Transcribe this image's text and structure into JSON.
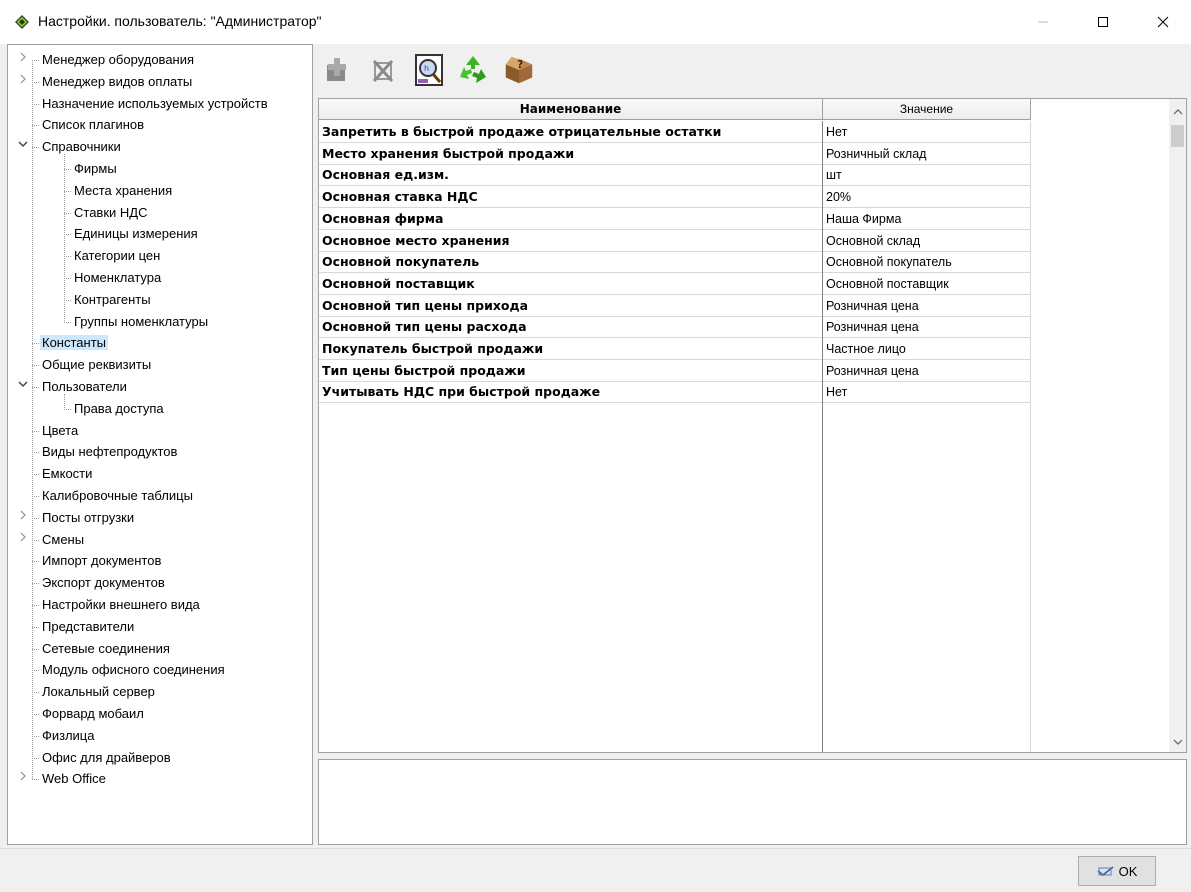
{
  "window": {
    "title": "Настройки. пользователь: \"Администратор\"",
    "min_icon": "minimize-icon",
    "max_icon": "maximize-icon",
    "close_icon": "close-icon"
  },
  "tree": [
    {
      "label": "Менеджер оборудования",
      "expander": ">",
      "level": 0
    },
    {
      "label": "Менеджер видов оплаты",
      "expander": ">",
      "level": 0
    },
    {
      "label": "Назначение используемых устройств",
      "expander": "",
      "level": 0
    },
    {
      "label": "Список плагинов",
      "expander": "",
      "level": 0
    },
    {
      "label": "Справочники",
      "expander": "v",
      "level": 0
    },
    {
      "label": "Фирмы",
      "expander": "",
      "level": 1
    },
    {
      "label": "Места хранения",
      "expander": "",
      "level": 1
    },
    {
      "label": "Ставки НДС",
      "expander": "",
      "level": 1
    },
    {
      "label": "Единицы измерения",
      "expander": "",
      "level": 1
    },
    {
      "label": "Категории цен",
      "expander": "",
      "level": 1
    },
    {
      "label": "Номенклатура",
      "expander": "",
      "level": 1
    },
    {
      "label": "Контрагенты",
      "expander": "",
      "level": 1
    },
    {
      "label": "Группы номенклатуры",
      "expander": "",
      "level": 1
    },
    {
      "label": "Константы",
      "expander": "",
      "level": 0,
      "selected": true
    },
    {
      "label": "Общие реквизиты",
      "expander": "",
      "level": 0
    },
    {
      "label": "Пользователи",
      "expander": "v",
      "level": 0
    },
    {
      "label": "Права доступа",
      "expander": "",
      "level": 1
    },
    {
      "label": "Цвета",
      "expander": "",
      "level": 0
    },
    {
      "label": "Виды нефтепродуктов",
      "expander": "",
      "level": 0
    },
    {
      "label": "Емкости",
      "expander": "",
      "level": 0
    },
    {
      "label": "Калибровочные таблицы",
      "expander": "",
      "level": 0
    },
    {
      "label": "Посты отгрузки",
      "expander": ">",
      "level": 0
    },
    {
      "label": "Смены",
      "expander": ">",
      "level": 0
    },
    {
      "label": "Импорт документов",
      "expander": "",
      "level": 0
    },
    {
      "label": "Экспорт документов",
      "expander": "",
      "level": 0
    },
    {
      "label": "Настройки внешнего вида",
      "expander": "",
      "level": 0
    },
    {
      "label": "Представители",
      "expander": "",
      "level": 0
    },
    {
      "label": "Сетевые соединения",
      "expander": "",
      "level": 0
    },
    {
      "label": "Модуль офисного соединения",
      "expander": "",
      "level": 0
    },
    {
      "label": "Локальный сервер",
      "expander": "",
      "level": 0
    },
    {
      "label": "Форвард мобаил",
      "expander": "",
      "level": 0
    },
    {
      "label": "Физлица",
      "expander": "",
      "level": 0
    },
    {
      "label": "Офис для драйверов",
      "expander": "",
      "level": 0
    },
    {
      "label": "Web Office",
      "expander": ">",
      "level": 0
    }
  ],
  "toolbar": {
    "buttons": [
      "add-icon",
      "delete-icon",
      "search-icon",
      "refresh-icon",
      "help-box-icon"
    ]
  },
  "grid": {
    "headers": {
      "name": "Наименование",
      "value": "Значение"
    },
    "rows": [
      {
        "name": "Запретить в быстрой продаже отрицательные остатки",
        "value": "Нет"
      },
      {
        "name": "Место хранения быстрой продажи",
        "value": "Розничный склад"
      },
      {
        "name": "Основная ед.изм.",
        "value": "шт"
      },
      {
        "name": "Основная ставка НДС",
        "value": "20%"
      },
      {
        "name": "Основная фирма",
        "value": "Наша Фирма"
      },
      {
        "name": "Основное место хранения",
        "value": "Основной склад"
      },
      {
        "name": "Основной покупатель",
        "value": "Основной покупатель"
      },
      {
        "name": "Основной поставщик",
        "value": "Основной поставщик"
      },
      {
        "name": "Основной тип цены прихода",
        "value": "Розничная цена"
      },
      {
        "name": "Основной тип цены расхода",
        "value": "Розничная цена"
      },
      {
        "name": "Покупатель быстрой продажи",
        "value": "Частное лицо"
      },
      {
        "name": "Тип цены быстрой продажи",
        "value": "Розничная цена"
      },
      {
        "name": "Учитывать НДС при быстрой продаже",
        "value": "Нет"
      }
    ]
  },
  "memo": {
    "text": ""
  },
  "footer": {
    "ok_label": "OK"
  }
}
